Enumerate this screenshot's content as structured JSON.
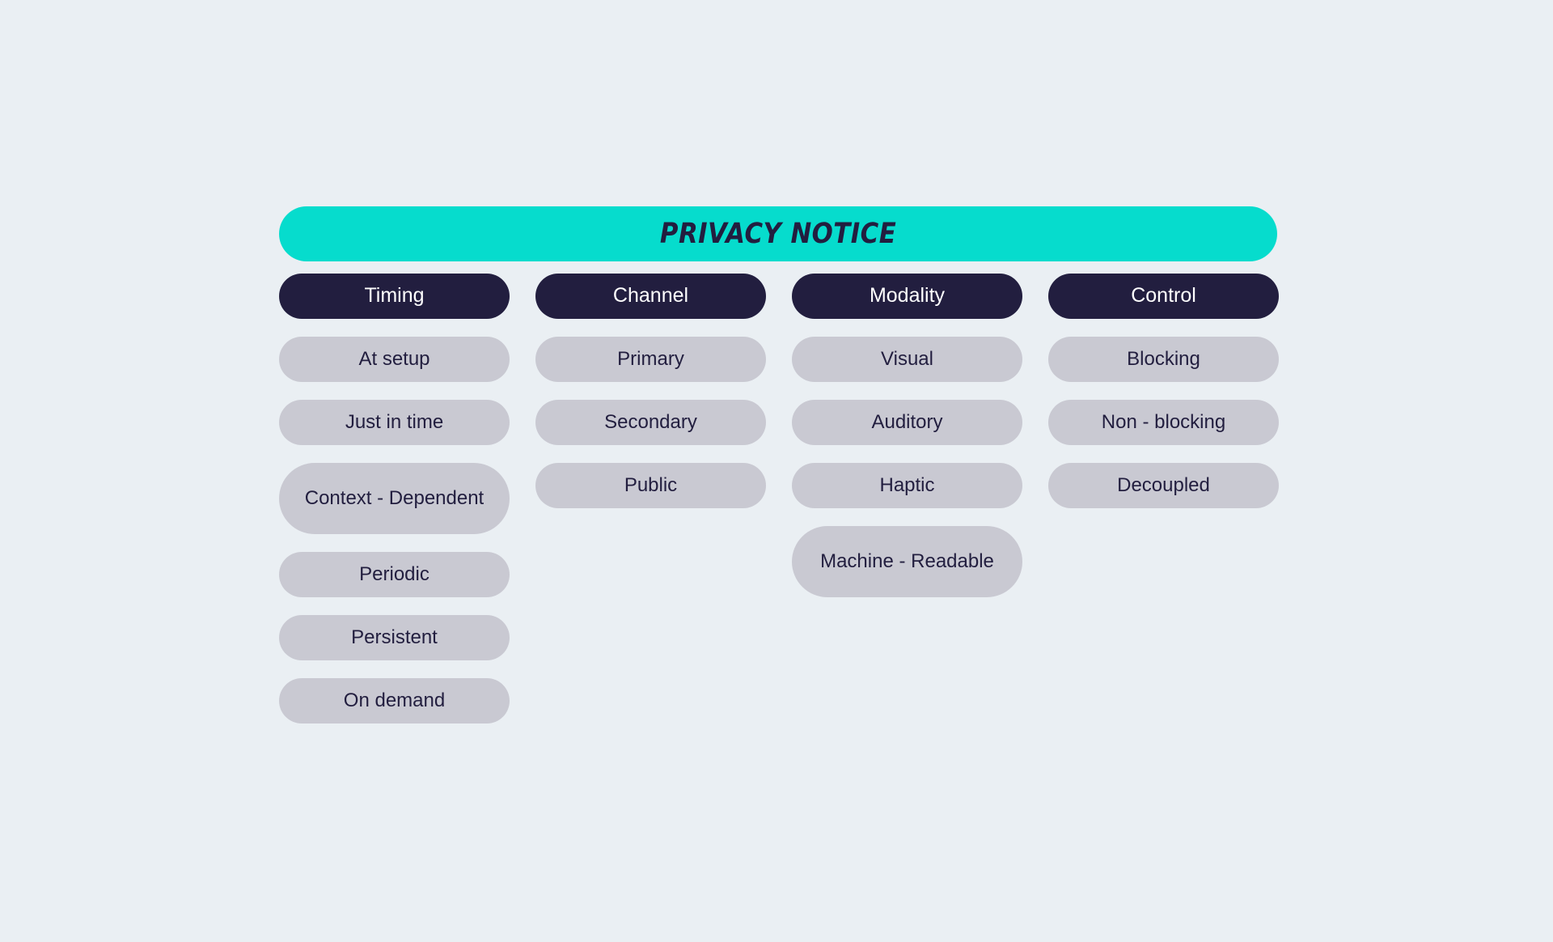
{
  "title": {
    "text": "PRIVACY NOTICE",
    "background_color": "#06dccd",
    "text_color": "#221e3f"
  },
  "theme": {
    "page_background": "#eaeff3",
    "header_pill_color": "#221e3f",
    "header_pill_text_color": "#ffffff",
    "item_pill_color": "#c9c9d2",
    "item_pill_text_color": "#221e3f",
    "accent_color": "#06dccd"
  },
  "columns": [
    {
      "header": "Timing",
      "items": [
        {
          "label": "At setup",
          "multiline": false
        },
        {
          "label": "Just in time",
          "multiline": false
        },
        {
          "label": "Context - Dependent",
          "multiline": true
        },
        {
          "label": "Periodic",
          "multiline": false
        },
        {
          "label": "Persistent",
          "multiline": false
        },
        {
          "label": "On demand",
          "multiline": false
        }
      ]
    },
    {
      "header": "Channel",
      "items": [
        {
          "label": "Primary",
          "multiline": false
        },
        {
          "label": "Secondary",
          "multiline": false
        },
        {
          "label": "Public",
          "multiline": false
        }
      ]
    },
    {
      "header": "Modality",
      "items": [
        {
          "label": "Visual",
          "multiline": false
        },
        {
          "label": "Auditory",
          "multiline": false
        },
        {
          "label": "Haptic",
          "multiline": false
        },
        {
          "label": "Machine - Readable",
          "multiline": true
        }
      ]
    },
    {
      "header": "Control",
      "items": [
        {
          "label": "Blocking",
          "multiline": false
        },
        {
          "label": "Non - blocking",
          "multiline": false
        },
        {
          "label": "Decoupled",
          "multiline": false
        }
      ]
    }
  ]
}
